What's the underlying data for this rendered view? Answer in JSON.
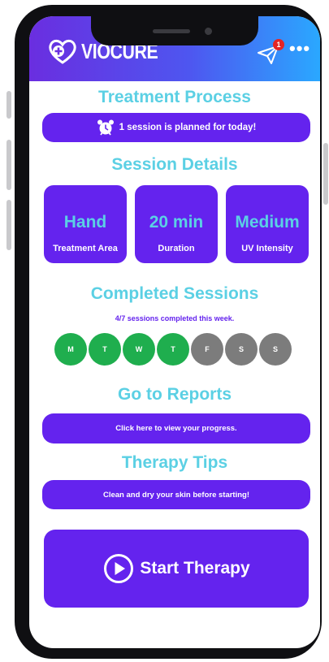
{
  "app": {
    "name": "VIOCURE"
  },
  "header": {
    "notification_count": "1"
  },
  "treatment": {
    "title": "Treatment Process",
    "banner": "1 session is planned for today!"
  },
  "session_details": {
    "title": "Session Details",
    "cards": [
      {
        "value": "Hand",
        "label": "Treatment Area"
      },
      {
        "value": "20 min",
        "label": "Duration"
      },
      {
        "value": "Medium",
        "label": "UV Intensity"
      }
    ]
  },
  "completed": {
    "title": "Completed Sessions",
    "summary": "4/7 sessions completed this week.",
    "completed_count": 4,
    "total": 7,
    "days": [
      {
        "label": "M",
        "done": true
      },
      {
        "label": "T",
        "done": true
      },
      {
        "label": "W",
        "done": true
      },
      {
        "label": "T",
        "done": true
      },
      {
        "label": "F",
        "done": false
      },
      {
        "label": "S",
        "done": false
      },
      {
        "label": "S",
        "done": false
      }
    ]
  },
  "reports": {
    "title": "Go to Reports",
    "link": "Click here to view your progress."
  },
  "tips": {
    "title": "Therapy Tips",
    "tip": "Clean and dry your skin before starting!"
  },
  "start": {
    "label": "Start Therapy"
  },
  "icons": {
    "logo": "heart-plus-icon",
    "send": "send-icon",
    "more": "more-icon",
    "alarm": "alarm-clock-icon",
    "play": "play-circle-icon"
  },
  "colors": {
    "primary": "#6423ee",
    "accent_text": "#5bd0e4",
    "done": "#1fae4e",
    "pending": "#7c7c7c",
    "badge": "#e52424"
  }
}
